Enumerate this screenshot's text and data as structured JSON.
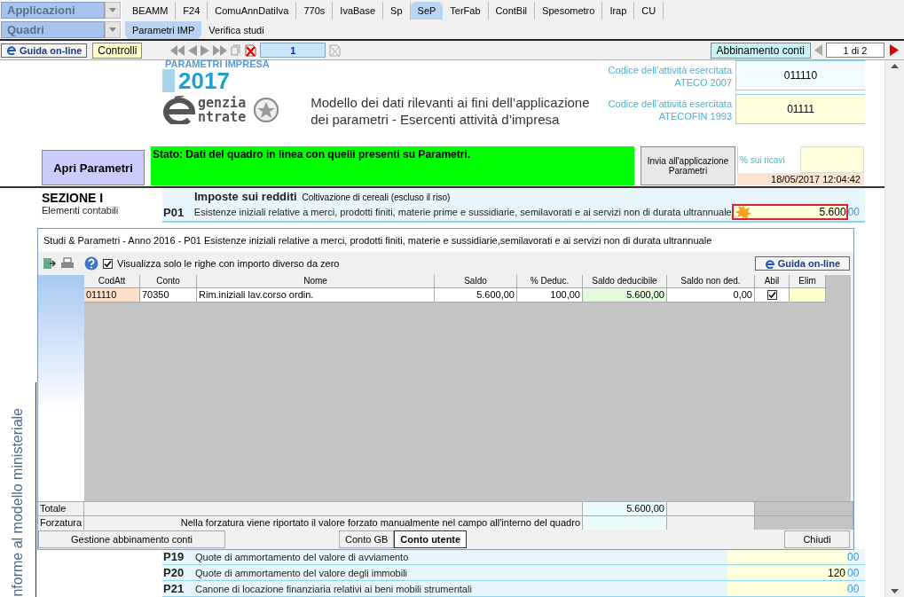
{
  "menu": {
    "applications": "Applicazioni",
    "quadri": "Quadri",
    "tabs": [
      {
        "label": "BEAMM",
        "selected": false
      },
      {
        "label": "F24",
        "selected": false
      },
      {
        "label": "ComuAnnDatiIva",
        "selected": false
      },
      {
        "label": "770s",
        "selected": false
      },
      {
        "label": "IvaBase",
        "selected": false
      },
      {
        "label": "Sp",
        "selected": false
      },
      {
        "label": "SeP",
        "selected": true
      },
      {
        "label": "TerFab",
        "selected": false
      },
      {
        "label": "ContBil",
        "selected": false
      },
      {
        "label": "Spesometro",
        "selected": false
      },
      {
        "label": "Irap",
        "selected": false
      },
      {
        "label": "CU",
        "selected": false
      }
    ],
    "subtabs": [
      {
        "label": "Parametri IMP",
        "selected": true
      },
      {
        "label": "Verifica studi",
        "selected": false
      }
    ]
  },
  "toolbar": {
    "help": "Guida on-line",
    "controls": "Controlli",
    "page_number": "1",
    "match_accounts": "Abbinamento conti",
    "page_indicator": "1 di 2"
  },
  "document": {
    "logo_title": "PARAMETRI IMPRESA",
    "logo_year": "2017",
    "agency_line1": "genzia",
    "agency_line2": "ntrate",
    "model_title": "Modello dei dati rilevanti ai fini dell’applicazione dei parametri - Esercenti attività d’impresa",
    "codes": [
      {
        "label": "Codice dell’attività esercitata",
        "sublabel": "ATECO 2007",
        "value": "011110",
        "kind": "plain"
      },
      {
        "label": "Codice dell’attività esercitata",
        "sublabel": "ATECOFIN 1993",
        "value": "01111",
        "kind": "yellow"
      }
    ],
    "open_button": "Apri Parametri",
    "status": "Stato: Dati del quadro in linea con quelli presenti su Parametri.",
    "send_button": "Invia all'applicazione Parametri",
    "revenue_label": "% sui ricavi",
    "timestamp": "18/05/2017 12:04:42",
    "section_title": "SEZIONE I",
    "section_subtitle": "Elementi contabili",
    "group_title": "Imposte sui redditi",
    "activity": "Coltivazione di cereali (escluso il riso)",
    "side_text": "nforme al modello ministeriale",
    "top_rows": [
      {
        "code": "P01",
        "label": "Esistenze iniziali relative a merci, prodotti finiti, materie prime e sussidiarie, semilavorati e ai servizi non di durata ultrannuale",
        "value": "5.600",
        "decimals": "00",
        "highlighted": true
      }
    ],
    "bottom_rows": [
      {
        "code": "P19",
        "label": "Quote di ammortamento del valore di avviamento",
        "decimals": "00",
        "highlighted": false
      },
      {
        "code": "P20",
        "label": "Quote di ammortamento del valore degli immobili",
        "value": "120",
        "decimals": "00",
        "highlighted": false
      },
      {
        "code": "P21",
        "label": "Canone di locazione finanziaria relativi ai beni mobili strumentali",
        "decimals": "00",
        "highlighted": false
      }
    ]
  },
  "dialog": {
    "title": "Studi & Parametri - Anno 2016 - P01 Esistenze iniziali relative a merci, prodotti finiti, materie e sussidiarie,semilavorati e ai servizi non di durata ultrannuale",
    "filter": {
      "label": "Visualizza solo le righe con importo diverso da zero",
      "checked": true
    },
    "help": "Guida on-line",
    "table": {
      "columns": [
        "CodAtt",
        "Conto",
        "Nome",
        "Saldo",
        "% Deduc.",
        "Saldo deducibile",
        "Saldo non ded.",
        "Abil",
        "Elim"
      ],
      "rows": [
        {
          "codatt": "011110",
          "conto": "70350",
          "nome": "Rim.iniziali lav.corso ordin.",
          "saldo": "5.600,00",
          "deduc": "100,00",
          "saldo_deducibile": "5.600,00",
          "saldo_non_ded": "0,00",
          "abil": true
        }
      ]
    },
    "total_label": "Totale",
    "total_value": "5.600,00",
    "override_label": "Forzatura",
    "override_note": "Nella forzatura viene riportato il valore forzato manualmente nel campo all'interno del quadro",
    "buttons": [
      {
        "label": "Gestione abbinamento conti",
        "kind": "left",
        "selected": false
      },
      {
        "label": "Conto GB",
        "kind": "center",
        "selected": false
      },
      {
        "label": "Conto utente",
        "kind": "center",
        "selected": true
      },
      {
        "label": "Chiudi",
        "kind": "right",
        "selected": false
      }
    ]
  }
}
